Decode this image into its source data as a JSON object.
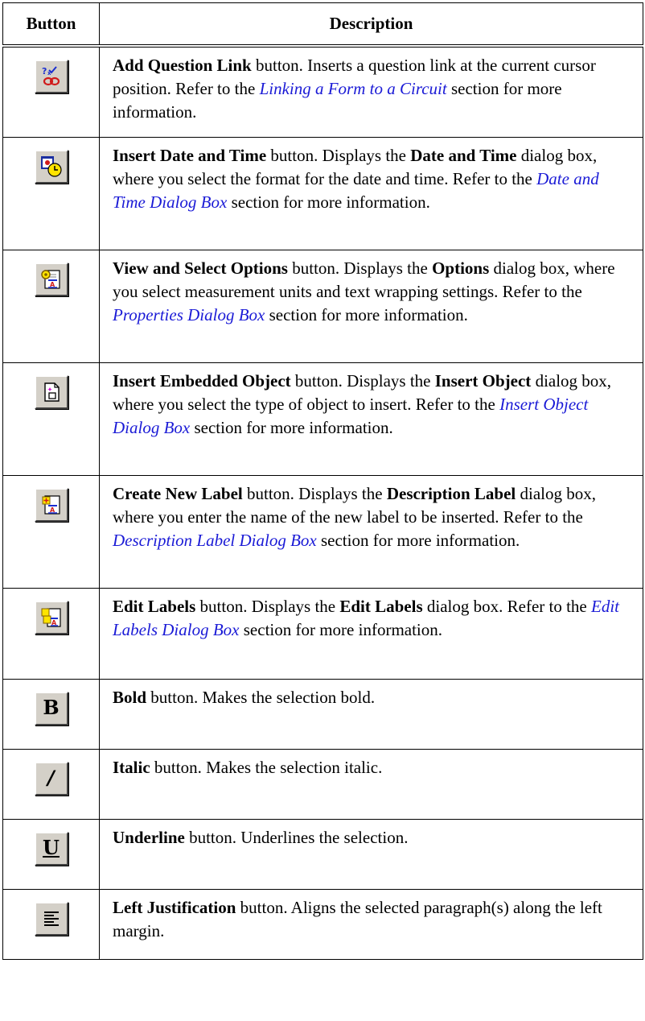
{
  "header": {
    "button": "Button",
    "description": "Description"
  },
  "rows": [
    {
      "icon": "add-question-link-icon",
      "parts": [
        {
          "t": "Add Question Link",
          "s": "b"
        },
        {
          "t": " button. Inserts a question link at the current cursor position. Refer to the ",
          "s": ""
        },
        {
          "t": "Linking a Form to a Circuit",
          "s": "link"
        },
        {
          "t": " section for more information.",
          "s": ""
        }
      ]
    },
    {
      "icon": "insert-date-time-icon",
      "parts": [
        {
          "t": "Insert Date and Time",
          "s": "b"
        },
        {
          "t": " button. Displays the ",
          "s": ""
        },
        {
          "t": "Date and Time",
          "s": "b"
        },
        {
          "t": " dialog box, where you select the format for the date and time. Refer to the ",
          "s": ""
        },
        {
          "t": "Date and Time Dialog Box",
          "s": "link"
        },
        {
          "t": " section for more information.",
          "s": ""
        }
      ]
    },
    {
      "icon": "view-select-options-icon",
      "parts": [
        {
          "t": "View and Select Options",
          "s": "b"
        },
        {
          "t": " button. Displays the ",
          "s": ""
        },
        {
          "t": "Options",
          "s": "b"
        },
        {
          "t": " dialog box, where you select measurement units and text wrapping settings. Refer to the ",
          "s": ""
        },
        {
          "t": "Properties Dialog Box",
          "s": "link"
        },
        {
          "t": " section for more information.",
          "s": ""
        }
      ]
    },
    {
      "icon": "insert-embedded-object-icon",
      "parts": [
        {
          "t": "Insert Embedded Object",
          "s": "b"
        },
        {
          "t": " button. Displays the ",
          "s": ""
        },
        {
          "t": "Insert Object",
          "s": "b"
        },
        {
          "t": " dialog box, where you select the type of object to insert. Refer to the ",
          "s": ""
        },
        {
          "t": "Insert Object Dialog Box",
          "s": "link"
        },
        {
          "t": " section for more information.",
          "s": ""
        }
      ]
    },
    {
      "icon": "create-new-label-icon",
      "parts": [
        {
          "t": "Create New Label",
          "s": "b"
        },
        {
          "t": " button. Displays the ",
          "s": ""
        },
        {
          "t": "Description Label",
          "s": "b"
        },
        {
          "t": " dialog box, where you enter the name of the new label to be inserted. Refer to the ",
          "s": ""
        },
        {
          "t": "Description Label Dialog Box",
          "s": "link"
        },
        {
          "t": " section for more information.",
          "s": ""
        }
      ]
    },
    {
      "icon": "edit-labels-icon",
      "parts": [
        {
          "t": "Edit Labels",
          "s": "b"
        },
        {
          "t": " button. Displays the ",
          "s": ""
        },
        {
          "t": "Edit Labels",
          "s": "b"
        },
        {
          "t": " dialog box. Refer to the ",
          "s": ""
        },
        {
          "t": "Edit Labels Dialog Box",
          "s": "link"
        },
        {
          "t": " section for more information.",
          "s": ""
        }
      ]
    },
    {
      "icon": "bold-icon",
      "glyph": "B",
      "parts": [
        {
          "t": "Bold",
          "s": "b"
        },
        {
          "t": " button. Makes the selection bold.",
          "s": ""
        }
      ]
    },
    {
      "icon": "italic-icon",
      "glyph": "/",
      "parts": [
        {
          "t": "Italic",
          "s": "b"
        },
        {
          "t": " button. Makes the selection italic.",
          "s": ""
        }
      ]
    },
    {
      "icon": "underline-icon",
      "glyph": "U",
      "parts": [
        {
          "t": "Underline",
          "s": "b"
        },
        {
          "t": " button. Underlines the selection.",
          "s": ""
        }
      ]
    },
    {
      "icon": "left-justify-icon",
      "parts": [
        {
          "t": "Left Justification",
          "s": "b"
        },
        {
          "t": " button. Aligns the selected paragraph(s) along the left margin.",
          "s": ""
        }
      ]
    }
  ]
}
